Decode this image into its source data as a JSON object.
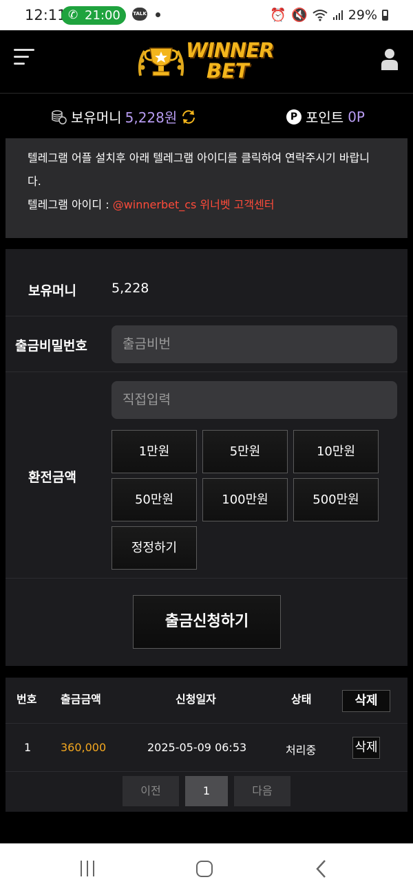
{
  "status_bar": {
    "time": "12:11",
    "call_time": "21:00",
    "talk_label": "TALK",
    "battery": "29%"
  },
  "header": {
    "logo_line1": "WINNER",
    "logo_line2": "BET"
  },
  "money_bar": {
    "balance_label": "보유머니",
    "balance_value": "5,228원",
    "point_symbol": "P",
    "point_label": "포인트",
    "point_value": "0P"
  },
  "notice": {
    "line1": "텔레그램 어플 설치후 아래 텔레그램 아이디를 클릭하여 연락주시기 바랍니",
    "line2": "다.",
    "id_label": "텔레그램 아이디 :",
    "id_value": "@winnerbet_cs 위너벳 고객센터"
  },
  "form": {
    "balance_label": "보유머니",
    "balance_value": "5,228",
    "password_label": "출금비밀번호",
    "password_placeholder": "출금비번",
    "amount_label": "환전금액",
    "amount_placeholder": "직접입력",
    "amount_buttons": [
      "1만원",
      "5만원",
      "10만원",
      "50만원",
      "100만원",
      "500만원"
    ],
    "reset_label": "정정하기",
    "submit_label": "출금신청하기"
  },
  "history": {
    "headers": {
      "no": "번호",
      "amount": "출금금액",
      "date": "신청일자",
      "status": "상태",
      "delete": "삭제"
    },
    "rows": [
      {
        "no": "1",
        "amount": "360,000",
        "date": "2025-05-09 06:53",
        "status": "처리중",
        "delete": "삭제"
      }
    ],
    "pager": {
      "prev": "이전",
      "current": "1",
      "next": "다음"
    }
  },
  "colors": {
    "accent_purple": "#b69bf0",
    "amount_orange": "#f4a820",
    "notice_red": "#ff4b3a",
    "logo_gold": "#f3b51c"
  }
}
